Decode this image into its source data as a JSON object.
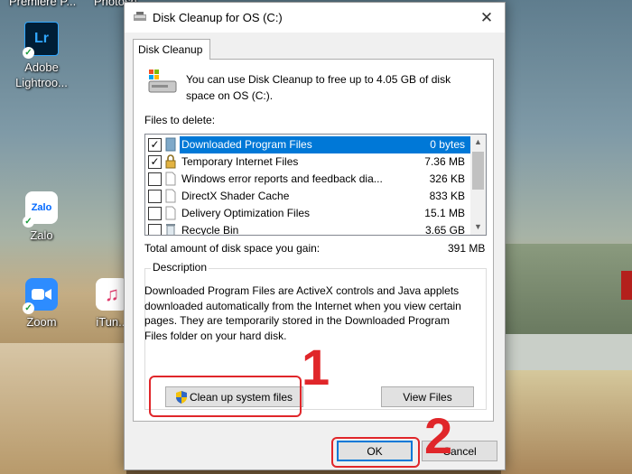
{
  "desktop": {
    "top_labels": [
      "Premiere P...",
      "Photosh..."
    ],
    "icons": [
      {
        "label": "Adobe Lightroo...",
        "glyph": "Lr",
        "name": "lightroom-icon"
      },
      {
        "label": "Zalo",
        "glyph": "Zalo",
        "name": "zalo-icon"
      },
      {
        "label": "Zoom",
        "glyph": "zoom-camera",
        "name": "zoom-icon"
      },
      {
        "label": "iTun...",
        "glyph": "music-note",
        "name": "itunes-icon"
      }
    ]
  },
  "dialog": {
    "title": "Disk Cleanup for OS (C:)",
    "close_glyph": "✕",
    "tab_label": "Disk Cleanup",
    "intro": "You can use Disk Cleanup to free up to 4.05 GB of disk space on OS (C:).",
    "files_label": "Files to delete:",
    "files": [
      {
        "name": "Downloaded Program Files",
        "size": "0 bytes",
        "checked": true,
        "selected": true,
        "icon": "folder-icon"
      },
      {
        "name": "Temporary Internet Files",
        "size": "7.36 MB",
        "checked": true,
        "selected": false,
        "icon": "lock-icon"
      },
      {
        "name": "Windows error reports and feedback dia...",
        "size": "326 KB",
        "checked": false,
        "selected": false,
        "icon": "file-icon"
      },
      {
        "name": "DirectX Shader Cache",
        "size": "833 KB",
        "checked": false,
        "selected": false,
        "icon": "file-icon"
      },
      {
        "name": "Delivery Optimization Files",
        "size": "15.1 MB",
        "checked": false,
        "selected": false,
        "icon": "file-icon"
      },
      {
        "name": "Recycle Bin",
        "size": "3.65 GB",
        "checked": false,
        "selected": false,
        "icon": "recycle-bin-icon"
      }
    ],
    "total_label": "Total amount of disk space you gain:",
    "total_value": "391 MB",
    "description_title": "Description",
    "description": "Downloaded Program Files are ActiveX controls and Java applets downloaded automatically from the Internet when you view certain pages. They are temporarily stored in the Downloaded Program Files folder on your hard disk.",
    "cleanup_button": "Clean up system files",
    "view_files_button": "View Files",
    "ok_button": "OK",
    "cancel_button": "Cancel"
  },
  "annotations": {
    "step1": "1",
    "step2": "2",
    "color": "#e0262a"
  },
  "colors": {
    "selection": "#0078d7",
    "accent": "#0078d7"
  }
}
